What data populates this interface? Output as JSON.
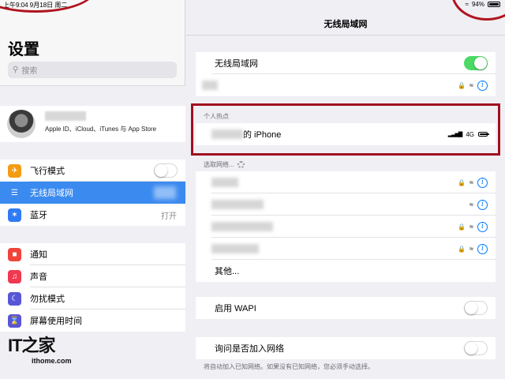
{
  "status": {
    "time": "上午9:04  9月18日 周二",
    "battery": "94%"
  },
  "sidebar": {
    "title": "设置",
    "search_placeholder": "搜索",
    "account_sub": "Apple ID、iCloud、iTunes 与 App Store",
    "items": [
      {
        "label": "飞行模式",
        "icon": "airplane-icon",
        "color": "#f39c12"
      },
      {
        "label": "无线局域网",
        "icon": "wifi-icon",
        "color": "#3b8af0"
      },
      {
        "label": "蓝牙",
        "icon": "bluetooth-icon",
        "color": "#2f7bf5",
        "value": "打开"
      },
      {
        "label": "通知",
        "icon": "notification-icon",
        "color": "#f0443a"
      },
      {
        "label": "声音",
        "icon": "sound-icon",
        "color": "#f0384f"
      },
      {
        "label": "勿扰模式",
        "icon": "moon-icon",
        "color": "#5856d6"
      },
      {
        "label": "屏幕使用时间",
        "icon": "hourglass-icon",
        "color": "#5856d6"
      }
    ],
    "logo": "IT之家",
    "logo_url": "ithome.com"
  },
  "main": {
    "title": "无线局域网",
    "wifi_label": "无线局域网",
    "wifi_on": true,
    "hotspot_section": "个人热点",
    "hotspot_name": "的 iPhone",
    "hotspot_network": "4G",
    "choose_section": "选取网络...",
    "other_label": "其他...",
    "wapi_label": "启用 WAPI",
    "ask_label": "询问是否加入网络",
    "ask_footnote": "将自动加入已知网络。如果没有已知网络，您必须手动选择。"
  }
}
